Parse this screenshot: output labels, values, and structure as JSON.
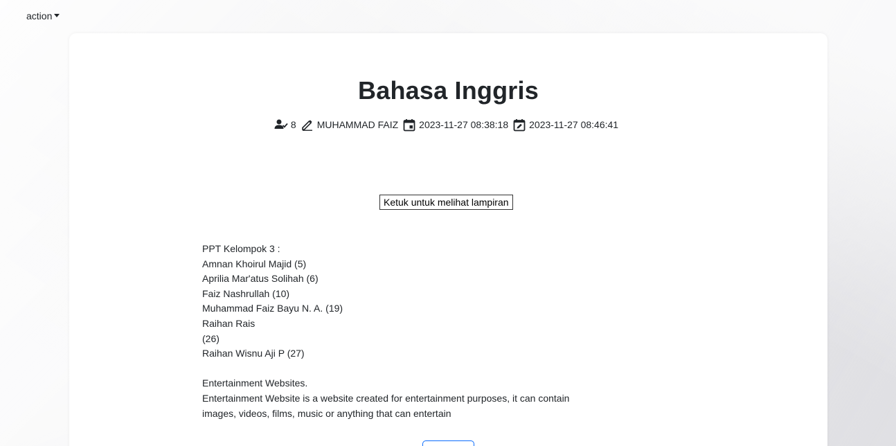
{
  "nav": {
    "action_label": "action"
  },
  "post": {
    "title": "Bahasa Inggris",
    "views": "8",
    "author": "MUHAMMAD FAIZ",
    "created": "2023-11-27 08:38:18",
    "updated": "2023-11-27 08:46:41",
    "attachment_button": "Ketuk untuk melihat lampiran",
    "body_lines": [
      "PPT Kelompok 3 :",
      "Amnan Khoirul Majid (5)",
      "Aprilia Mar'atus Solihah (6)",
      "Faiz Nashrullah (10)",
      "Muhammad Faiz Bayu N. A. (19)",
      "Raihan Rais",
      "(26)",
      "Raihan Wisnu Aji P (27)",
      "",
      "Entertainment Websites.",
      "Entertainment Website is a website created for entertainment purposes, it can contain",
      "images, videos, films, music or anything that can entertain"
    ]
  },
  "icons": {
    "views": "person-check-icon",
    "author": "pencil-icon",
    "created": "calendar-event-icon",
    "updated": "calendar-edit-icon"
  },
  "colors": {
    "accent": "#0d6efd",
    "text": "#212529"
  }
}
